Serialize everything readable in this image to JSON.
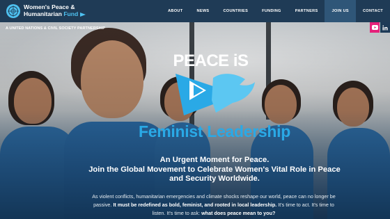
{
  "header": {
    "logo_line1": "Women's Peace &",
    "logo_line2a": "Humanitarian",
    "logo_line2b": "Fund",
    "nav": [
      "ABOUT",
      "NEWS",
      "COUNTRIES",
      "FUNDING",
      "PARTNERS",
      "JOIN US",
      "CONTACT"
    ],
    "active_nav": "JOIN US"
  },
  "partnership": "A UNITED NATIONS & CIVIL SOCIETY PARTNERSHIP",
  "social": {
    "youtube_icon": "youtube-icon",
    "linkedin_icon": "linkedin-icon",
    "youtube_color": "#e5207a"
  },
  "hero": {
    "peace_is": "PEACE iS",
    "dove_icon": "dove-icon",
    "campaign_title": "Feminist Leadership",
    "headline_line1": "An Urgent Moment for Peace.",
    "headline_line2": "Join the Global Movement to Celebrate Women's Vital Role in Peace and Security Worldwide.",
    "body_intro": "As violent conflicts, humanitarian emergencies and climate shocks reshape our world, peace can no longer be passive.",
    "body_bold": "It must be redefined as bold, feminist, and rooted in local leadership.",
    "body_mid": "It's time to act. It's time to listen. It's time to ask:",
    "body_question": "what does peace mean to you?"
  },
  "colors": {
    "header_bg": "#1f3b56",
    "accent_blue": "#2aa9e6",
    "fund_blue": "#4ec1f0"
  }
}
